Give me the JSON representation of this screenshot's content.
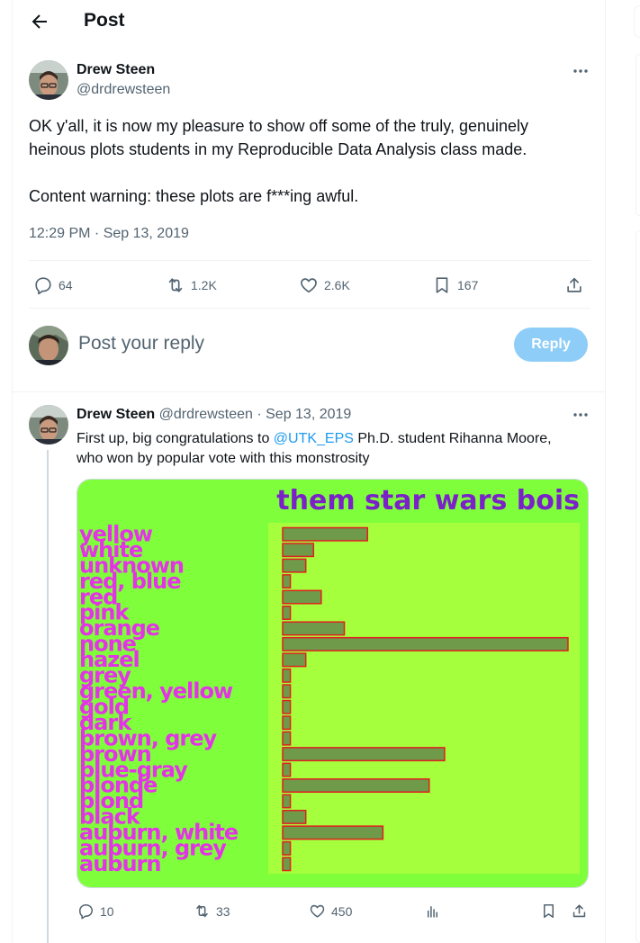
{
  "header": {
    "title": "Post"
  },
  "tweet": {
    "author_name": "Drew Steen",
    "author_handle": "@drdrewsteen",
    "text_line1": "OK y'all, it is now my pleasure to show off some of the truly, genuinely heinous plots students in my Reproducible Data Analysis class made.",
    "text_line2": "Content warning: these plots are f***ing awful.",
    "timestamp": "12:29 PM · Sep 13, 2019",
    "stats": {
      "replies": "64",
      "reposts": "1.2K",
      "likes": "2.6K",
      "bookmarks": "167"
    }
  },
  "composer": {
    "placeholder": "Post your reply",
    "button_label": "Reply"
  },
  "reply": {
    "author_name": "Drew Steen",
    "author_handle": "@drdrewsteen",
    "date": "· Sep 13, 2019",
    "text_before": "First up, big congratulations to ",
    "mention": "@UTK_EPS",
    "text_after": " Ph.D. student Rihanna Moore, who won by popular vote with this monstrosity",
    "stats": {
      "replies": "10",
      "reposts": "33",
      "likes": "450"
    }
  },
  "colors": {
    "accent": "#1d9bf0",
    "reply_button": "#8ecdf8",
    "chart_bg": "#7fff3c",
    "panel_bg": "#a6ff3c",
    "label": "#e433e6",
    "title": "#7a22c8"
  },
  "chart_data": {
    "type": "bar",
    "orientation": "horizontal",
    "title": "them star wars bois",
    "categories": [
      "yellow",
      "white",
      "unknown",
      "red, blue",
      "red",
      "pink",
      "orange",
      "none",
      "hazel",
      "grey",
      "green, yellow",
      "gold",
      "dark",
      "brown, grey",
      "brown",
      "blue-gray",
      "blonde",
      "blond",
      "black",
      "auburn, white",
      "auburn, grey",
      "auburn"
    ],
    "values": [
      11,
      4,
      3,
      1,
      5,
      1,
      8,
      37,
      3,
      1,
      1,
      1,
      1,
      1,
      21,
      1,
      19,
      1,
      3,
      13,
      1,
      1,
      1
    ],
    "grid": false,
    "legend": "none"
  }
}
